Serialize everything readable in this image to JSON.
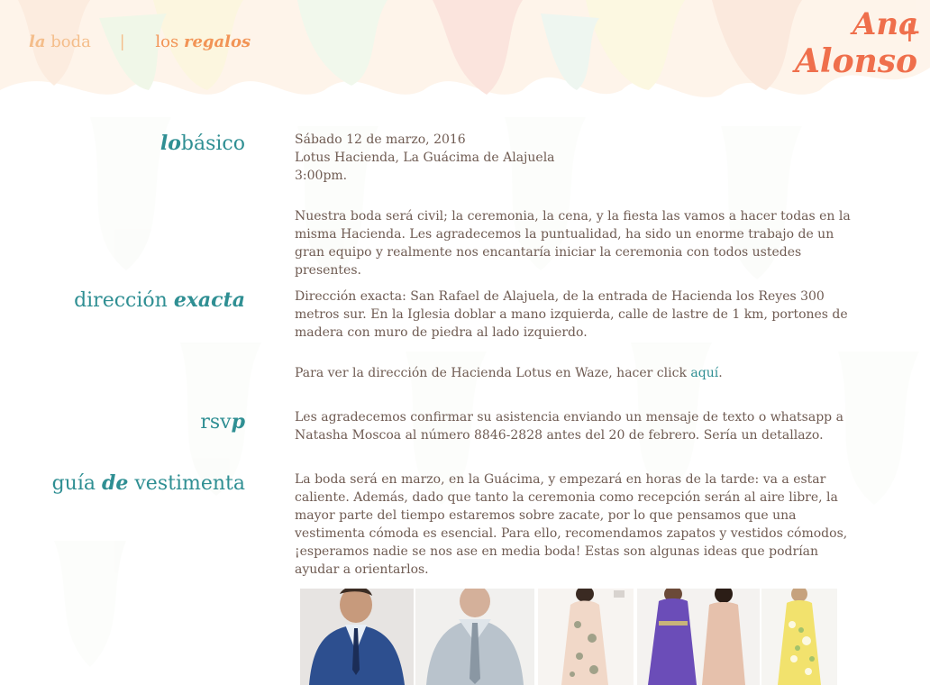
{
  "nav": {
    "item1_em": "la",
    "item1_rest": "boda",
    "separator": "|",
    "item2_pre": "los",
    "item2_em": "regalos"
  },
  "logo": {
    "line1": "Ana",
    "line2": "Alonso",
    "plus": "+"
  },
  "sections": {
    "basico": {
      "label_em": "lo",
      "label_rest": "básico",
      "date_line": "Sábado 12 de marzo, 2016",
      "venue_line": "Lotus Hacienda, La Guácima de Alajuela",
      "time_line": "3:00pm.",
      "paragraph": "Nuestra boda será civil; la ceremonia, la cena, y la fiesta las vamos a hacer todas en la misma Hacienda. Les agradecemos la puntualidad, ha sido un enorme trabajo de un gran equipo y realmente nos encantaría iniciar la ceremonia con todos ustedes presentes."
    },
    "direccion": {
      "label_rest": "dirección",
      "label_em": "exacta",
      "paragraph": "Dirección exacta: San Rafael de Alajuela, de la entrada de Hacienda los Reyes 300 metros sur. En la Iglesia doblar a mano izquierda, calle de lastre de 1 km, portones de madera con muro de piedra al lado izquierdo.",
      "waze_text": "Para ver la dirección de Hacienda Lotus en Waze, hacer click",
      "waze_link": "aquí",
      "waze_end": "."
    },
    "rsvp": {
      "label_pre": "rsv",
      "label_em": "p",
      "paragraph": "Les agradecemos confirmar su asistencia enviando un mensaje de texto o whatsapp a Natasha Moscoa al número 8846-2828 antes del 20 de febrero. Sería un detallazo."
    },
    "vestimenta": {
      "label_pre": "guía",
      "label_em": "de",
      "label_rest": "vestimenta",
      "paragraph": "La boda será en marzo, en la Guácima, y empezará en horas de la tarde: va a estar caliente. Además, dado que tanto la ceremonia como recepción serán al aire libre, la mayor parte del tiempo estaremos sobre zacate, por lo que pensamos que una vestimenta cómoda es esencial. Para ello, recomendamos zapatos y vestidos cómodos, ¡esperamos nadie se nos ase en media boda! Estas son algunas ideas que podrían ayudar a orientarlos."
    }
  },
  "gallery": [
    {
      "name": "outfit-photo-blue-blazer"
    },
    {
      "name": "outfit-photo-grey-suit"
    },
    {
      "name": "outfit-photo-floral-dress"
    },
    {
      "name": "outfit-photo-purple-gowns"
    },
    {
      "name": "outfit-photo-yellow-dress"
    }
  ],
  "colors": {
    "teal": "#2f8f93",
    "orange": "#f29456",
    "peach": "#f4bd8a",
    "body_text": "#6f5b52",
    "logo": "#ef6f4c"
  }
}
